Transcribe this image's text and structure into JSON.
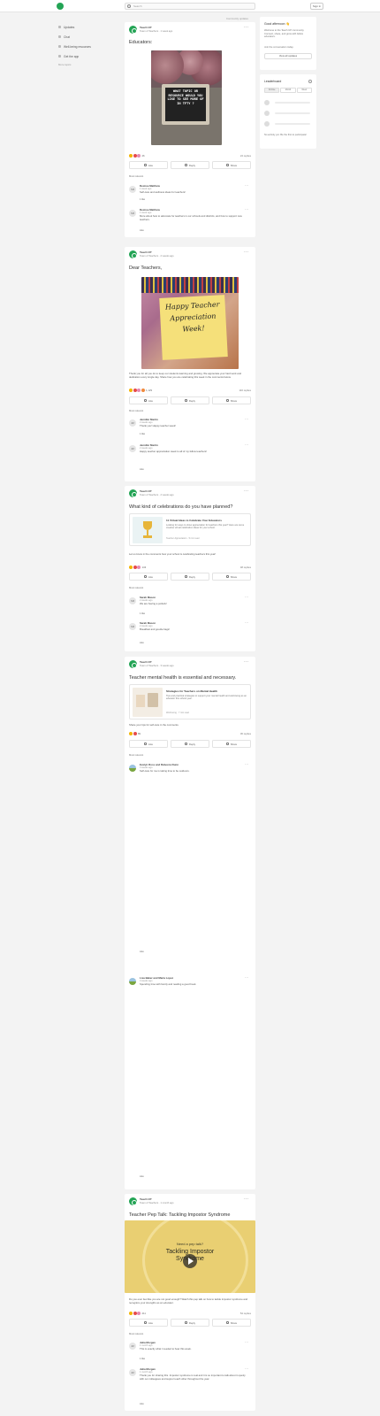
{
  "header": {
    "search_placeholder": "Search",
    "sign_in": "Sign in"
  },
  "leftnav": {
    "items": [
      {
        "label": "Updates"
      },
      {
        "label": "Chat"
      },
      {
        "label": "Well-being resources"
      },
      {
        "label": "Get the app"
      }
    ],
    "footer": "More topics"
  },
  "feed_note": "Community updates",
  "posts": [
    {
      "author": "Teach UP",
      "meta": "Team of Teachers · 1 week ago",
      "title": "Educators:",
      "image_text": "WHAT TOPIC OR RESOURCE WOULD YOU LIKE TO SEE MORE OF IN TFTY ?",
      "reactions_count": "26",
      "shares": "24 replies",
      "actions": [
        "Like",
        "Reply",
        "Share"
      ],
      "comments_label": "Most relevant",
      "comments": [
        {
          "initials": "SM",
          "name": "Desiree Matthew",
          "meta": "1 week ago",
          "text": "Self-care and wellness ideas for teachers!",
          "likes": "1 like"
        },
        {
          "initials": "SM",
          "name": "Desiree Matthew",
          "meta": "1 week ago",
          "text": "More about how to advocate for teachers in our schools and districts, and how to support new teachers.",
          "likes": "Like"
        }
      ]
    },
    {
      "author": "Teach UP",
      "meta": "Team of Teachers · 2 weeks ago",
      "title": "Dear Teachers,",
      "image_text": "Happy Teacher Appreciation Week!",
      "body": "Thank you for all you do to keep our students learning and growing. We appreciate your hard work and dedication every single day. Share how you are celebrating this week in the comments below.",
      "reactions_count": "1,129",
      "shares": "116 replies",
      "actions": [
        "Like",
        "Reply",
        "Share"
      ],
      "comments_label": "Most relevant",
      "comments": [
        {
          "initials": "JM",
          "name": "Jennifer Martin",
          "meta": "2 weeks ago",
          "text": "Thank you! Happy teacher week!",
          "likes": "1 like"
        },
        {
          "initials": "JM",
          "name": "Jennifer Martin",
          "meta": "2 weeks ago",
          "text": "Happy teacher appreciation week to all of my fellow teachers!",
          "likes": "Like"
        }
      ]
    },
    {
      "author": "Teach UP",
      "meta": "Team of Teachers · 2 weeks ago",
      "title": "What kind of celebrations do you have planned?",
      "link_title": "11 Virtual Ideas to Celebrate Your Educators",
      "link_desc": "Looking for ways to show appreciation for teachers this year? Here are some creative virtual celebration ideas for your school.",
      "link_meta": "Teacher Appreciation · 5 min read",
      "body": "Let us know in the comments how your school is celebrating teachers this year!",
      "reactions_count": "143",
      "shares": "48 replies",
      "actions": [
        "Like",
        "Reply",
        "Share"
      ],
      "comments_label": "Most relevant",
      "comments": [
        {
          "initials": "SM",
          "name": "Sarah Mason",
          "meta": "2 weeks ago",
          "text": "We are having a potluck!",
          "likes": "1 like"
        },
        {
          "initials": "SM",
          "name": "Sarah Mason",
          "meta": "2 weeks ago",
          "text": "Breakfast and goodie bags!",
          "likes": "Like"
        }
      ]
    },
    {
      "author": "Teach UP",
      "meta": "Team of Teachers · 3 weeks ago",
      "title": "Teacher mental health is essential and necessary.",
      "link_title": "Strategies for Teachers on Mental Health",
      "link_desc": "Tips and practical strategies to support your mental health and well-being as an educator this school year.",
      "link_meta": "Well-being · 7 min read",
      "body": "Share your tips for self-care in the comments.",
      "reactions_count": "89",
      "shares": "36 replies",
      "actions": [
        "Like",
        "Reply",
        "Share"
      ],
      "comments_label": "Most relevant",
      "comments": [
        {
          "name": "Evelyn Ross and Rebecca Dunn",
          "meta": "3 weeks ago",
          "text": "Self-care for me is taking time to be outdoors.",
          "likes": "Like"
        },
        {
          "name": "Lisa Baker and Maria Lopez",
          "meta": "3 weeks ago",
          "text": "Spending time with family and reading a good book.",
          "likes": "Like"
        }
      ]
    },
    {
      "author": "Teach UP",
      "meta": "Team of Teachers · 1 month ago",
      "title": "Teacher Pep Talk: Tackling Impostor Syndrome",
      "video_kicker": "Need a pep talk?",
      "video_title": "Tackling Impostor Syndrome",
      "body": "Do you ever feel like you are not good enough? Watch this pep talk on how to tackle impostor syndrome and recognize your strengths as an educator.",
      "reactions_count": "211",
      "shares": "54 replies",
      "actions": [
        "Like",
        "Reply",
        "Share"
      ],
      "comments_label": "Most relevant",
      "comments": [
        {
          "initials": "JM",
          "name": "Julia Morgan",
          "meta": "1 month ago",
          "text": "This is exactly what I needed to hear this week.",
          "likes": "1 like"
        },
        {
          "initials": "JM",
          "name": "Julia Morgan",
          "meta": "1 month ago",
          "text": "Thank you for sharing this. Impostor syndrome is real and it is so important to talk about it openly with our colleagues and support each other throughout the year.",
          "likes": "Like"
        }
      ]
    }
  ],
  "sidebar": {
    "welcome_title": "Good afternoon 👋",
    "welcome_text": "Welcome to the Teach UP community. Connect, share, and grow with fellow educators.",
    "welcome_note": "Join the conversation today.",
    "welcome_button": "View all updates",
    "leaderboard_title": "Leaderboard",
    "leaderboard_tabs": [
      "All time",
      "Month",
      "Week"
    ],
    "leaderboard_note": "No activity yet. Be the first to participate!"
  },
  "colors": {
    "brand": "#23a455",
    "background": "#f3f3f3"
  }
}
